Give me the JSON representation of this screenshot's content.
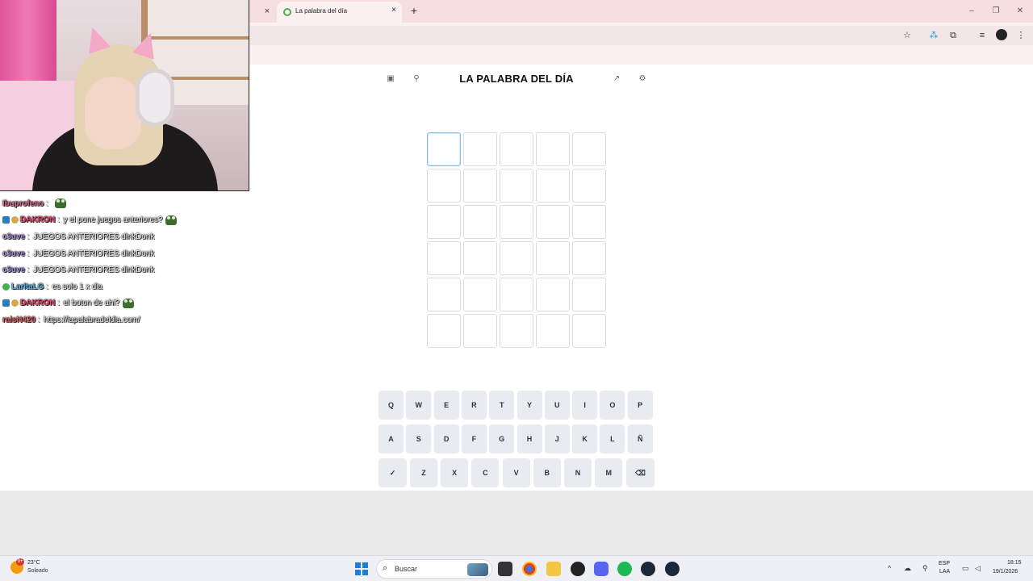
{
  "chat": [
    {
      "badges": [],
      "user": "Ibuprofeno",
      "user_color": "#d46b8a",
      "message": "",
      "emote": true
    },
    {
      "badges": [
        "blue",
        "gold"
      ],
      "user": "DAKRON",
      "user_color": "#e8476a",
      "message": "y el pone juegos anteriores?",
      "emote": true
    },
    {
      "badges": [],
      "user": "c3uve",
      "user_color": "#a78bd8",
      "message": "JUEGOS ANTERIORES dinkDonk",
      "emote": false
    },
    {
      "badges": [],
      "user": "c3uve",
      "user_color": "#a78bd8",
      "message": "JUEGOS ANTERIORES dinkDonk",
      "emote": false
    },
    {
      "badges": [],
      "user": "c3uve",
      "user_color": "#a78bd8",
      "message": "JUEGOS ANTERIORES dinkDonk",
      "emote": false
    },
    {
      "badges": [
        "green"
      ],
      "user": "LaritaLG",
      "user_color": "#5fb3e0",
      "message": "es solo 1 x dia",
      "emote": false
    },
    {
      "badges": [
        "blue",
        "gold"
      ],
      "user": "DAKRON",
      "user_color": "#e8476a",
      "message": "el boton de ahi?",
      "emote": true
    },
    {
      "badges": [],
      "user": "raisN420",
      "user_color": "#d95f5f",
      "message": "https://lapalabradeldia.com/",
      "emote": false
    }
  ],
  "browser": {
    "tab_title": "La palabra del día",
    "tab_close": "×",
    "new_tab": "+",
    "window_controls": [
      "–",
      "❐",
      "✕"
    ]
  },
  "game": {
    "title": "LA PALABRA DEL DÍA",
    "rows": 6,
    "cols": 5,
    "keyboard": [
      [
        "Q",
        "W",
        "E",
        "R",
        "T",
        "Y",
        "U",
        "I",
        "O",
        "P"
      ],
      [
        "A",
        "S",
        "D",
        "F",
        "G",
        "H",
        "J",
        "K",
        "L",
        "Ñ"
      ],
      [
        "✓",
        "Z",
        "X",
        "C",
        "V",
        "B",
        "N",
        "M",
        "⌫"
      ]
    ]
  },
  "taskbar": {
    "weather_badge": "9+",
    "temperature": "23°C",
    "weather": "Soleado",
    "search_label": "Buscar",
    "language_line1": "ESP",
    "language_line2": "LAA",
    "time": "18:15",
    "date": "19/1/2026"
  }
}
